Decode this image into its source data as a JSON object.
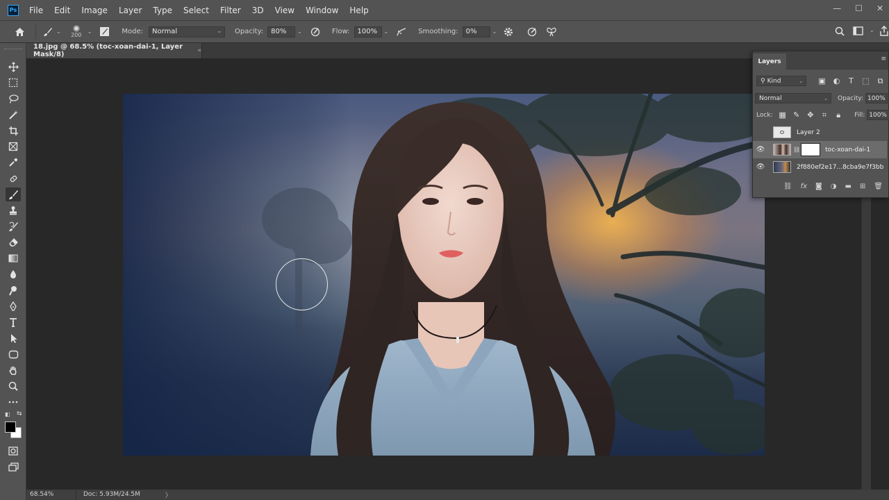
{
  "app": {
    "logo": "Ps",
    "menu": [
      "File",
      "Edit",
      "Image",
      "Layer",
      "Type",
      "Select",
      "Filter",
      "3D",
      "View",
      "Window",
      "Help"
    ],
    "window_controls": [
      "—",
      "☐",
      "✕"
    ]
  },
  "options_bar": {
    "brush_size": "200",
    "mode_label": "Mode:",
    "mode_value": "Normal",
    "opacity_label": "Opacity:",
    "opacity_value": "80%",
    "flow_label": "Flow:",
    "flow_value": "100%",
    "smoothing_label": "Smoothing:",
    "smoothing_value": "0%"
  },
  "document": {
    "tab_title": "18.jpg @ 68.5% (toc-xoan-dai-1, Layer Mask/8)",
    "tab_close": "«"
  },
  "status_bar": {
    "zoom": "68.54%",
    "doc_info": "Doc: 5.93M/24.5M",
    "arrow": "〉"
  },
  "layers_panel": {
    "title": "Layers",
    "kind_label": "Kind",
    "blend_mode": "Normal",
    "opacity_label": "Opacity:",
    "opacity_value": "100%",
    "lock_label": "Lock:",
    "fill_label": "Fill:",
    "fill_value": "100%",
    "layers": [
      {
        "name": "Layer 2",
        "visible": false,
        "selected": false
      },
      {
        "name": "toc-xoan-dai-1",
        "visible": true,
        "selected": true
      },
      {
        "name": "2f880ef2e17...8cba9e7f3bb",
        "visible": true,
        "selected": false
      }
    ]
  },
  "colors": {
    "foreground": "#000000",
    "background": "#ffffff",
    "ui_panel": "#535353",
    "canvas_bg": "#282828"
  }
}
